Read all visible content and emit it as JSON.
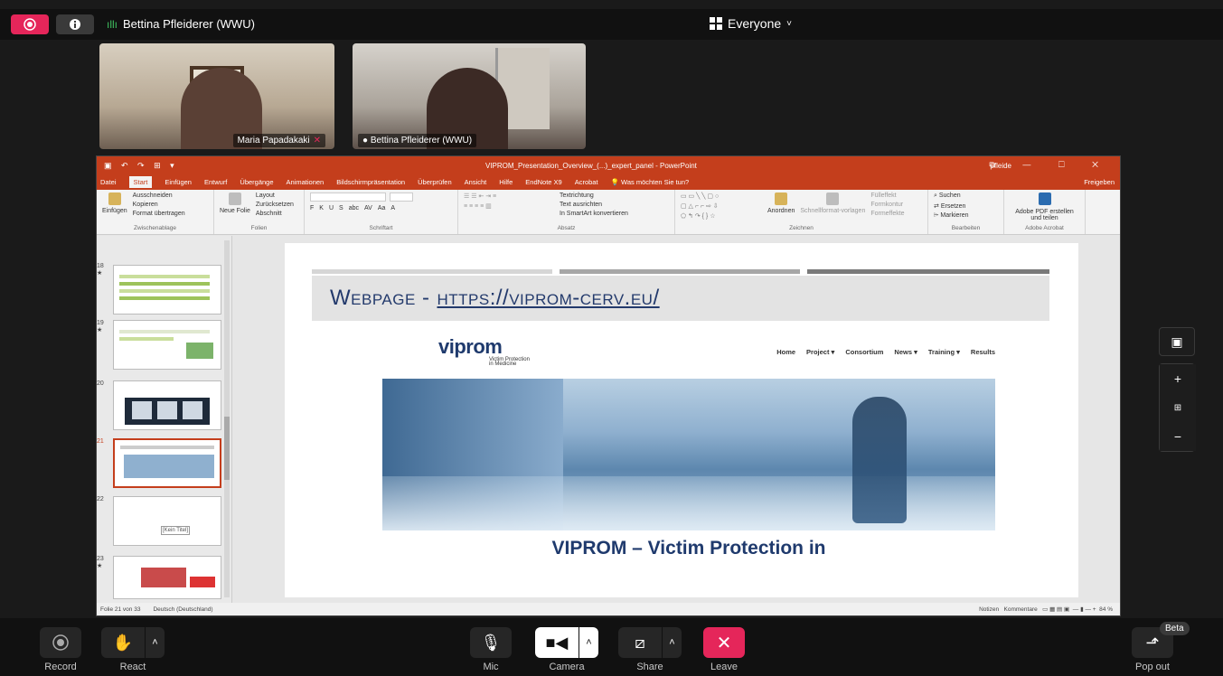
{
  "topbar": {
    "speaker_name": "Bettina Pfleiderer (WWU)",
    "view_label": "Everyone"
  },
  "videos": [
    {
      "name": "Maria Papadakaki",
      "muted": true
    },
    {
      "name": "Bettina Pfleiderer (WWU)",
      "muted": false
    }
  ],
  "powerpoint": {
    "window_title": "VIPROM_Presentation_Overview_(...)_expert_panel - PowerPoint",
    "user": "pfleide",
    "share": "Freigeben",
    "tabs": [
      "Datei",
      "Start",
      "Einfügen",
      "Entwurf",
      "Übergänge",
      "Animationen",
      "Bildschirmpräsentation",
      "Überprüfen",
      "Ansicht",
      "Hilfe",
      "EndNote X9",
      "Acrobat",
      "Was möchten Sie tun?"
    ],
    "active_tab": "Start",
    "ribbon_groups": [
      {
        "label": "Zwischenablage",
        "items": [
          "Einfügen",
          "Ausschneiden",
          "Kopieren",
          "Format übertragen"
        ]
      },
      {
        "label": "Folien",
        "items": [
          "Neue Folie",
          "Layout",
          "Zurücksetzen",
          "Abschnitt"
        ]
      },
      {
        "label": "Schriftart",
        "items": [
          "F",
          "K",
          "U",
          "S",
          "abc",
          "AV",
          "Aa",
          "A"
        ]
      },
      {
        "label": "Absatz",
        "items": [
          "Textrichtung",
          "Text ausrichten",
          "In SmartArt konvertieren"
        ]
      },
      {
        "label": "Zeichnen",
        "items": [
          "Anordnen",
          "Schnellformat-vorlagen",
          "Fülleffekt",
          "Formkontur",
          "Formeffekte"
        ]
      },
      {
        "label": "Bearbeiten",
        "items": [
          "Suchen",
          "Ersetzen",
          "Markieren"
        ]
      },
      {
        "label": "Adobe Acrobat",
        "items": [
          "Adobe PDF erstellen und teilen"
        ]
      }
    ],
    "thumbnails": [
      {
        "num": "18"
      },
      {
        "num": "19"
      },
      {
        "num": "20"
      },
      {
        "num": "21",
        "selected": true
      },
      {
        "num": "22",
        "caption": "[Kein Titel]"
      },
      {
        "num": "23"
      }
    ],
    "status_left": "Folie 21 von 33",
    "status_lang": "Deutsch (Deutschland)",
    "status_notes": "Notizen",
    "status_comments": "Kommentare",
    "status_zoom": "84 %"
  },
  "slide": {
    "heading": "Webpage -",
    "heading_link": "https://viprom-cerv.eu/",
    "logo_text": "viprom",
    "logo_sub_1": "Victim Protection",
    "logo_sub_2": "in Medicine",
    "nav": [
      "Home",
      "Project ▾",
      "Consortium",
      "News ▾",
      "Training ▾",
      "Results"
    ],
    "web_title": "VIPROM – Victim Protection in"
  },
  "toolbar": {
    "record": "Record",
    "react": "React",
    "mic": "Mic",
    "camera": "Camera",
    "share": "Share",
    "leave": "Leave",
    "popout": "Pop out",
    "beta": "Beta"
  },
  "colors": {
    "accent_red": "#e5265a",
    "ppt_orange": "#c43e1c",
    "viprom_blue": "#1f3a6d",
    "speaking_green": "#3fbf5f"
  }
}
